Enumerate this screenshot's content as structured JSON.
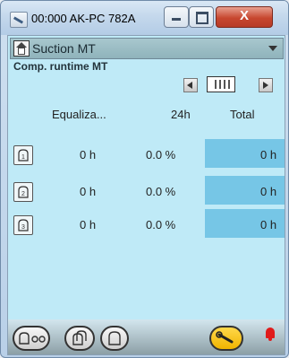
{
  "window": {
    "title": "00:000 AK-PC 782A",
    "close_symbol": "X"
  },
  "selector": {
    "label": "Suction MT"
  },
  "section": {
    "title": "Comp. runtime MT"
  },
  "columns": {
    "equalize": "Equaliza...",
    "h24": "24h",
    "total": "Total"
  },
  "rows": [
    {
      "number": "1",
      "equalize": "0 h",
      "h24": "0.0 %",
      "total": "0 h"
    },
    {
      "number": "2",
      "equalize": "0 h",
      "h24": "0.0 %",
      "total": "0 h"
    },
    {
      "number": "3",
      "equalize": "0 h",
      "h24": "0.0 %",
      "total": "0 h"
    }
  ],
  "icons": {
    "app": "app-window-icon",
    "home": "home-icon",
    "dropdown": "chevron-down-icon",
    "prev": "arrow-left-icon",
    "next": "arrow-right-icon",
    "compressor": "compressor-icon",
    "alarm": "alarm-bell-icon",
    "service": "wrench-icon"
  },
  "colors": {
    "content_bg": "#bfeaf7",
    "total_highlight": "#76c6e6",
    "alarm": "#e01b1b",
    "service": "#f0b400"
  }
}
